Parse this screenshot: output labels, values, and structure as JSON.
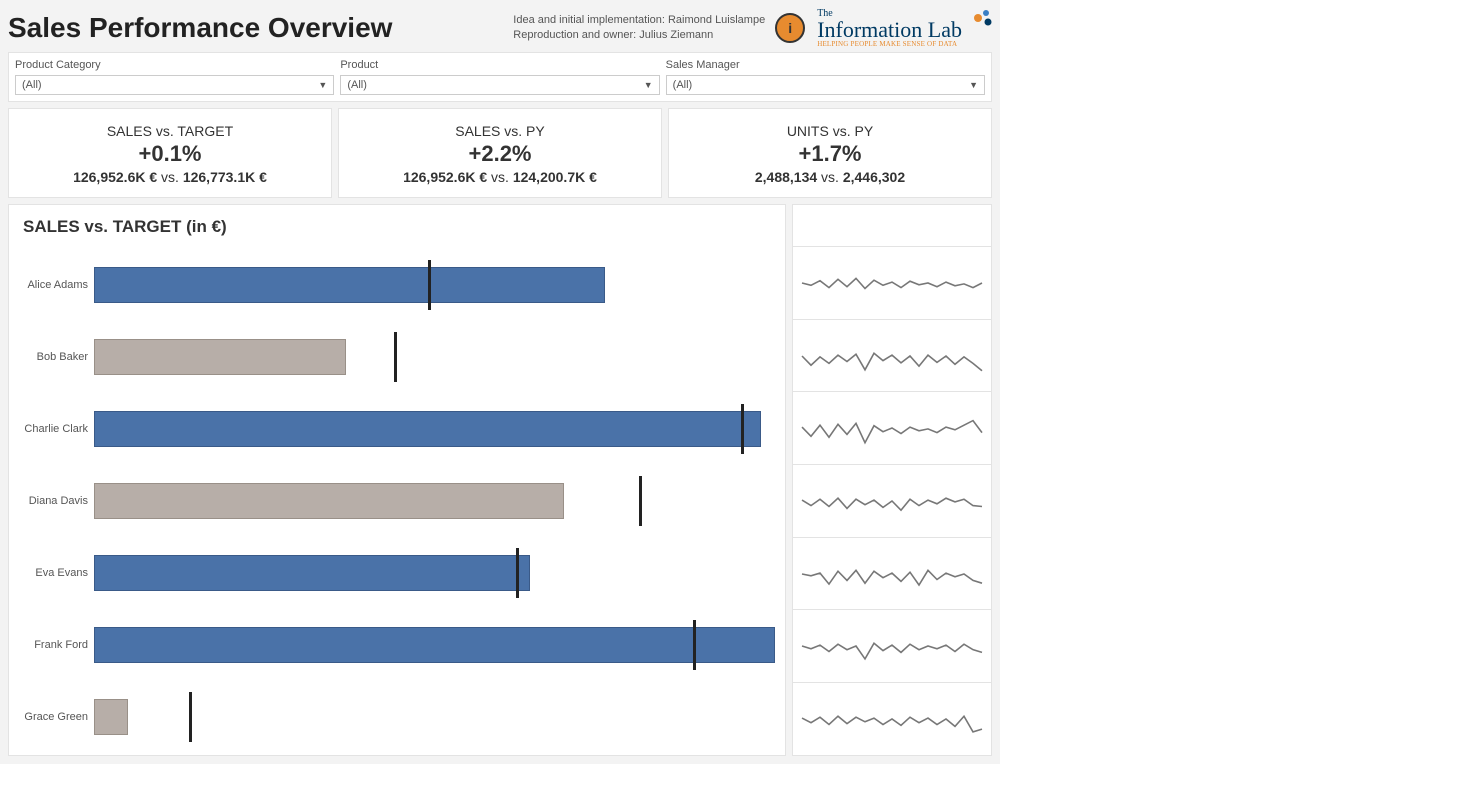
{
  "header": {
    "title": "Sales Performance Overview",
    "credits_line1": "Idea and initial implementation: Raimond Luislampe",
    "credits_line2": "Reproduction and owner: Julius Ziemann",
    "info_icon": "i",
    "logo_the": "The",
    "logo_main": "Information Lab",
    "logo_tag": "HELPING PEOPLE MAKE SENSE OF DATA"
  },
  "filters": {
    "category_label": "Product Category",
    "category_value": "(All)",
    "product_label": "Product",
    "product_value": "(All)",
    "manager_label": "Sales Manager",
    "manager_value": "(All)"
  },
  "kpi": {
    "k1_label": "SALES vs. TARGET",
    "k1_value": "+0.1%",
    "k1_a": "126,952.6K €",
    "k1_vs": " vs. ",
    "k1_b": "126,773.1K €",
    "k2_label": "SALES vs. PY",
    "k2_value": "+2.2%",
    "k2_a": "126,952.6K €",
    "k2_vs": " vs. ",
    "k2_b": "124,200.7K €",
    "k3_label": "UNITS vs. PY",
    "k3_value": "+1.7%",
    "k3_a": "2,488,134",
    "k3_vs": " vs. ",
    "k3_b": "2,446,302"
  },
  "bullet_title": "SALES vs. TARGET (in €)",
  "chart_data": {
    "type": "bar",
    "title": "SALES vs. TARGET (in €)",
    "xlabel": "",
    "ylabel": "",
    "note": "Values are approximate percentages of chart width (0-100). Bar = actual sales, Target = target marker position. above_target = bar color (blue if actual >= target, gray if below).",
    "series": [
      {
        "name": "Alice Adams",
        "actual": 75,
        "target": 49,
        "above_target": true
      },
      {
        "name": "Bob Baker",
        "actual": 37,
        "target": 44,
        "above_target": false
      },
      {
        "name": "Charlie Clark",
        "actual": 98,
        "target": 95,
        "above_target": true
      },
      {
        "name": "Diana Davis",
        "actual": 69,
        "target": 80,
        "above_target": false
      },
      {
        "name": "Eva Evans",
        "actual": 64,
        "target": 62,
        "above_target": true
      },
      {
        "name": "Frank Ford",
        "actual": 100,
        "target": 88,
        "above_target": true
      },
      {
        "name": "Grace Green",
        "actual": 5,
        "target": 14,
        "above_target": false
      }
    ],
    "sparklines": [
      [
        50,
        55,
        45,
        60,
        42,
        58,
        40,
        62,
        44,
        55,
        48,
        60,
        46,
        54,
        50,
        58,
        48,
        56,
        52,
        60,
        50
      ],
      [
        50,
        70,
        52,
        66,
        48,
        62,
        46,
        80,
        44,
        60,
        48,
        65,
        50,
        72,
        48,
        64,
        50,
        68,
        52,
        66,
        82
      ],
      [
        48,
        68,
        44,
        70,
        42,
        64,
        40,
        82,
        45,
        58,
        50,
        62,
        48,
        56,
        52,
        60,
        48,
        54,
        44,
        34,
        60
      ],
      [
        48,
        60,
        46,
        62,
        44,
        66,
        46,
        58,
        48,
        64,
        50,
        70,
        46,
        60,
        48,
        56,
        44,
        52,
        46,
        60,
        62
      ],
      [
        50,
        54,
        48,
        72,
        44,
        64,
        42,
        70,
        44,
        58,
        48,
        66,
        46,
        74,
        42,
        62,
        48,
        56,
        50,
        64,
        70
      ],
      [
        50,
        56,
        48,
        62,
        46,
        58,
        50,
        78,
        44,
        60,
        48,
        64,
        46,
        58,
        50,
        56,
        48,
        62,
        46,
        58,
        64
      ],
      [
        48,
        58,
        46,
        62,
        44,
        60,
        46,
        56,
        48,
        62,
        50,
        64,
        46,
        58,
        48,
        62,
        50,
        66,
        44,
        78,
        72
      ]
    ]
  }
}
